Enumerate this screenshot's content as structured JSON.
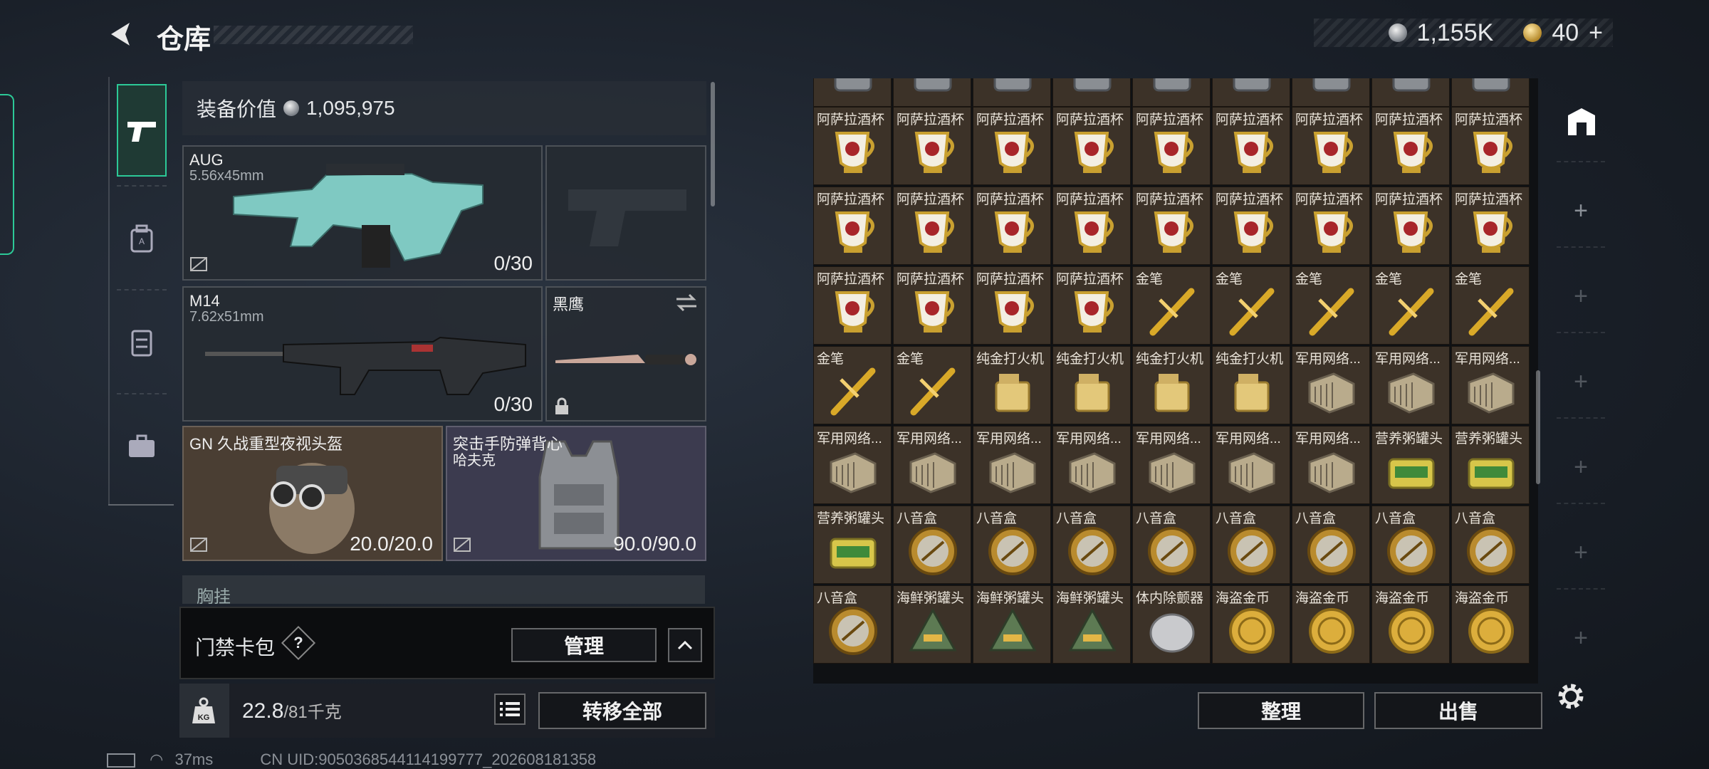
{
  "header": {
    "title": "仓库",
    "currency_silver": "1,155K",
    "currency_gold": "40",
    "plus_symbol": "+"
  },
  "equipment": {
    "value_label": "装备价值",
    "value": "1,095,975",
    "primary1": {
      "name": "AUG",
      "caliber": "5.56x45mm",
      "ammo": "0/30"
    },
    "primary2": {
      "name": "M14",
      "caliber": "7.62x51mm",
      "ammo": "0/30"
    },
    "melee": {
      "name": "黑鹰"
    },
    "helmet": {
      "name": "GN 久战重型夜视头盔",
      "durability": "20.0/20.0"
    },
    "armor": {
      "name": "突击手防弹背心",
      "name2": "哈夫克",
      "durability": "90.0/90.0"
    },
    "chest_peek": "胸挂"
  },
  "keycard": {
    "label": "门禁卡包",
    "help": "?",
    "manage_label": "管理"
  },
  "weight": {
    "current": "22.8",
    "max": "/81千克",
    "transfer_all_label": "转移全部"
  },
  "inventory": {
    "columns": 9,
    "rows": [
      [
        "",
        "",
        "",
        "",
        "",
        "",
        "",
        "",
        ""
      ],
      [
        "阿萨拉酒杯",
        "阿萨拉酒杯",
        "阿萨拉酒杯",
        "阿萨拉酒杯",
        "阿萨拉酒杯",
        "阿萨拉酒杯",
        "阿萨拉酒杯",
        "阿萨拉酒杯",
        "阿萨拉酒杯"
      ],
      [
        "阿萨拉酒杯",
        "阿萨拉酒杯",
        "阿萨拉酒杯",
        "阿萨拉酒杯",
        "阿萨拉酒杯",
        "阿萨拉酒杯",
        "阿萨拉酒杯",
        "阿萨拉酒杯",
        "阿萨拉酒杯"
      ],
      [
        "阿萨拉酒杯",
        "阿萨拉酒杯",
        "阿萨拉酒杯",
        "阿萨拉酒杯",
        "金笔",
        "金笔",
        "金笔",
        "金笔",
        "金笔"
      ],
      [
        "金笔",
        "金笔",
        "纯金打火机",
        "纯金打火机",
        "纯金打火机",
        "纯金打火机",
        "军用网络...",
        "军用网络...",
        "军用网络..."
      ],
      [
        "军用网络...",
        "军用网络...",
        "军用网络...",
        "军用网络...",
        "军用网络...",
        "军用网络...",
        "军用网络...",
        "营养粥罐头",
        "营养粥罐头"
      ],
      [
        "营养粥罐头",
        "八音盒",
        "八音盒",
        "八音盒",
        "八音盒",
        "八音盒",
        "八音盒",
        "八音盒",
        "八音盒"
      ],
      [
        "八音盒",
        "海鲜粥罐头",
        "海鲜粥罐头",
        "海鲜粥罐头",
        "体内除颤器",
        "海盗金币",
        "海盗金币",
        "海盗金币",
        "海盗金币"
      ]
    ],
    "sort_label": "整理",
    "sell_label": "出售"
  },
  "footer": {
    "ping": "37ms",
    "uid": "CN UID:9050368544114199777_202608181358"
  },
  "colors": {
    "accent": "#2cc997",
    "cell_bg": "#3c3228"
  }
}
